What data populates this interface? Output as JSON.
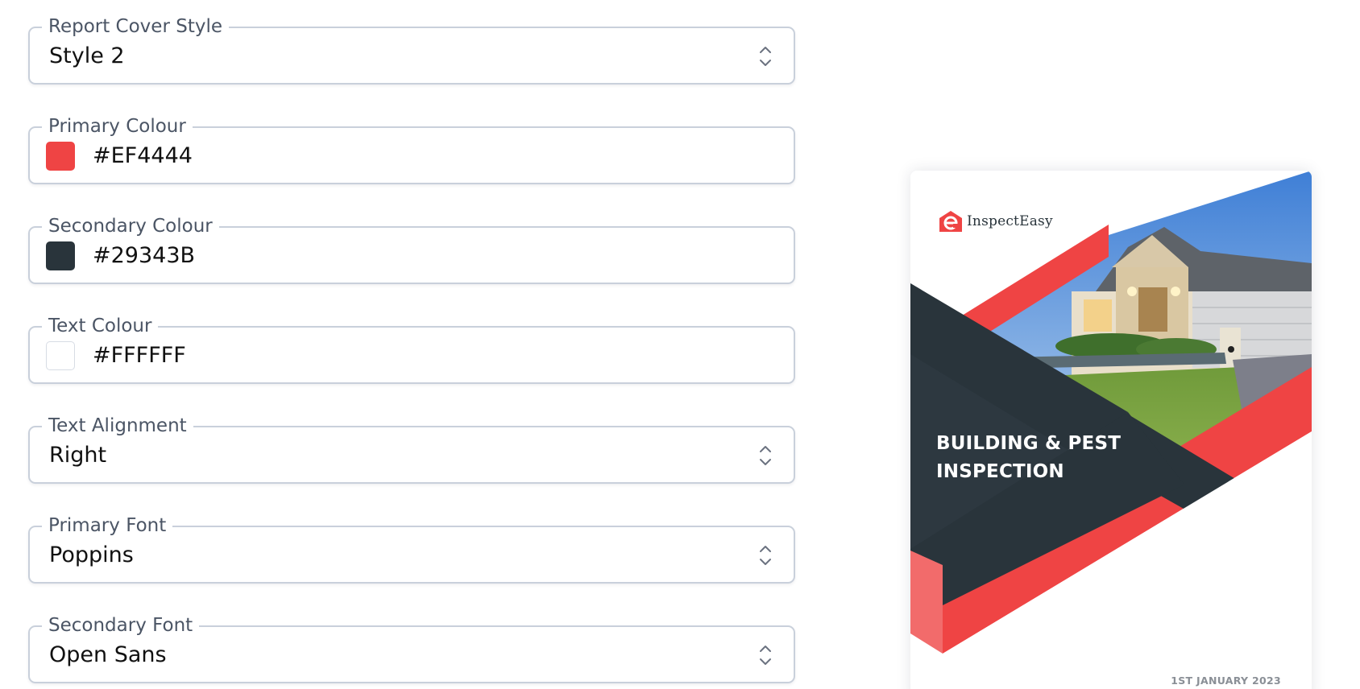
{
  "form": {
    "report_cover_style": {
      "label": "Report Cover Style",
      "value": "Style 2"
    },
    "primary_colour": {
      "label": "Primary Colour",
      "value": "#EF4444",
      "swatch": "#EF4444"
    },
    "secondary_colour": {
      "label": "Secondary Colour",
      "value": "#29343B",
      "swatch": "#29343B"
    },
    "text_colour": {
      "label": "Text Colour",
      "value": "#FFFFFF",
      "swatch": "#FFFFFF"
    },
    "text_alignment": {
      "label": "Text Alignment",
      "value": "Right"
    },
    "primary_font": {
      "label": "Primary Font",
      "value": "Poppins"
    },
    "secondary_font": {
      "label": "Secondary Font",
      "value": "Open Sans"
    }
  },
  "preview": {
    "brand_name": "InspectEasy",
    "title_line1": "BUILDING & PEST",
    "title_line2": "INSPECTION",
    "date": "1ST JANUARY 2023",
    "photo_subject": "house-photo"
  },
  "icons": {
    "select": "chevron-up-down-icon",
    "logo": "inspecteasy-logo-icon"
  },
  "colors": {
    "primary": "#EF4444",
    "secondary": "#29343B",
    "text": "#FFFFFF",
    "border": "#C9D0DB",
    "label": "#4B5565"
  }
}
